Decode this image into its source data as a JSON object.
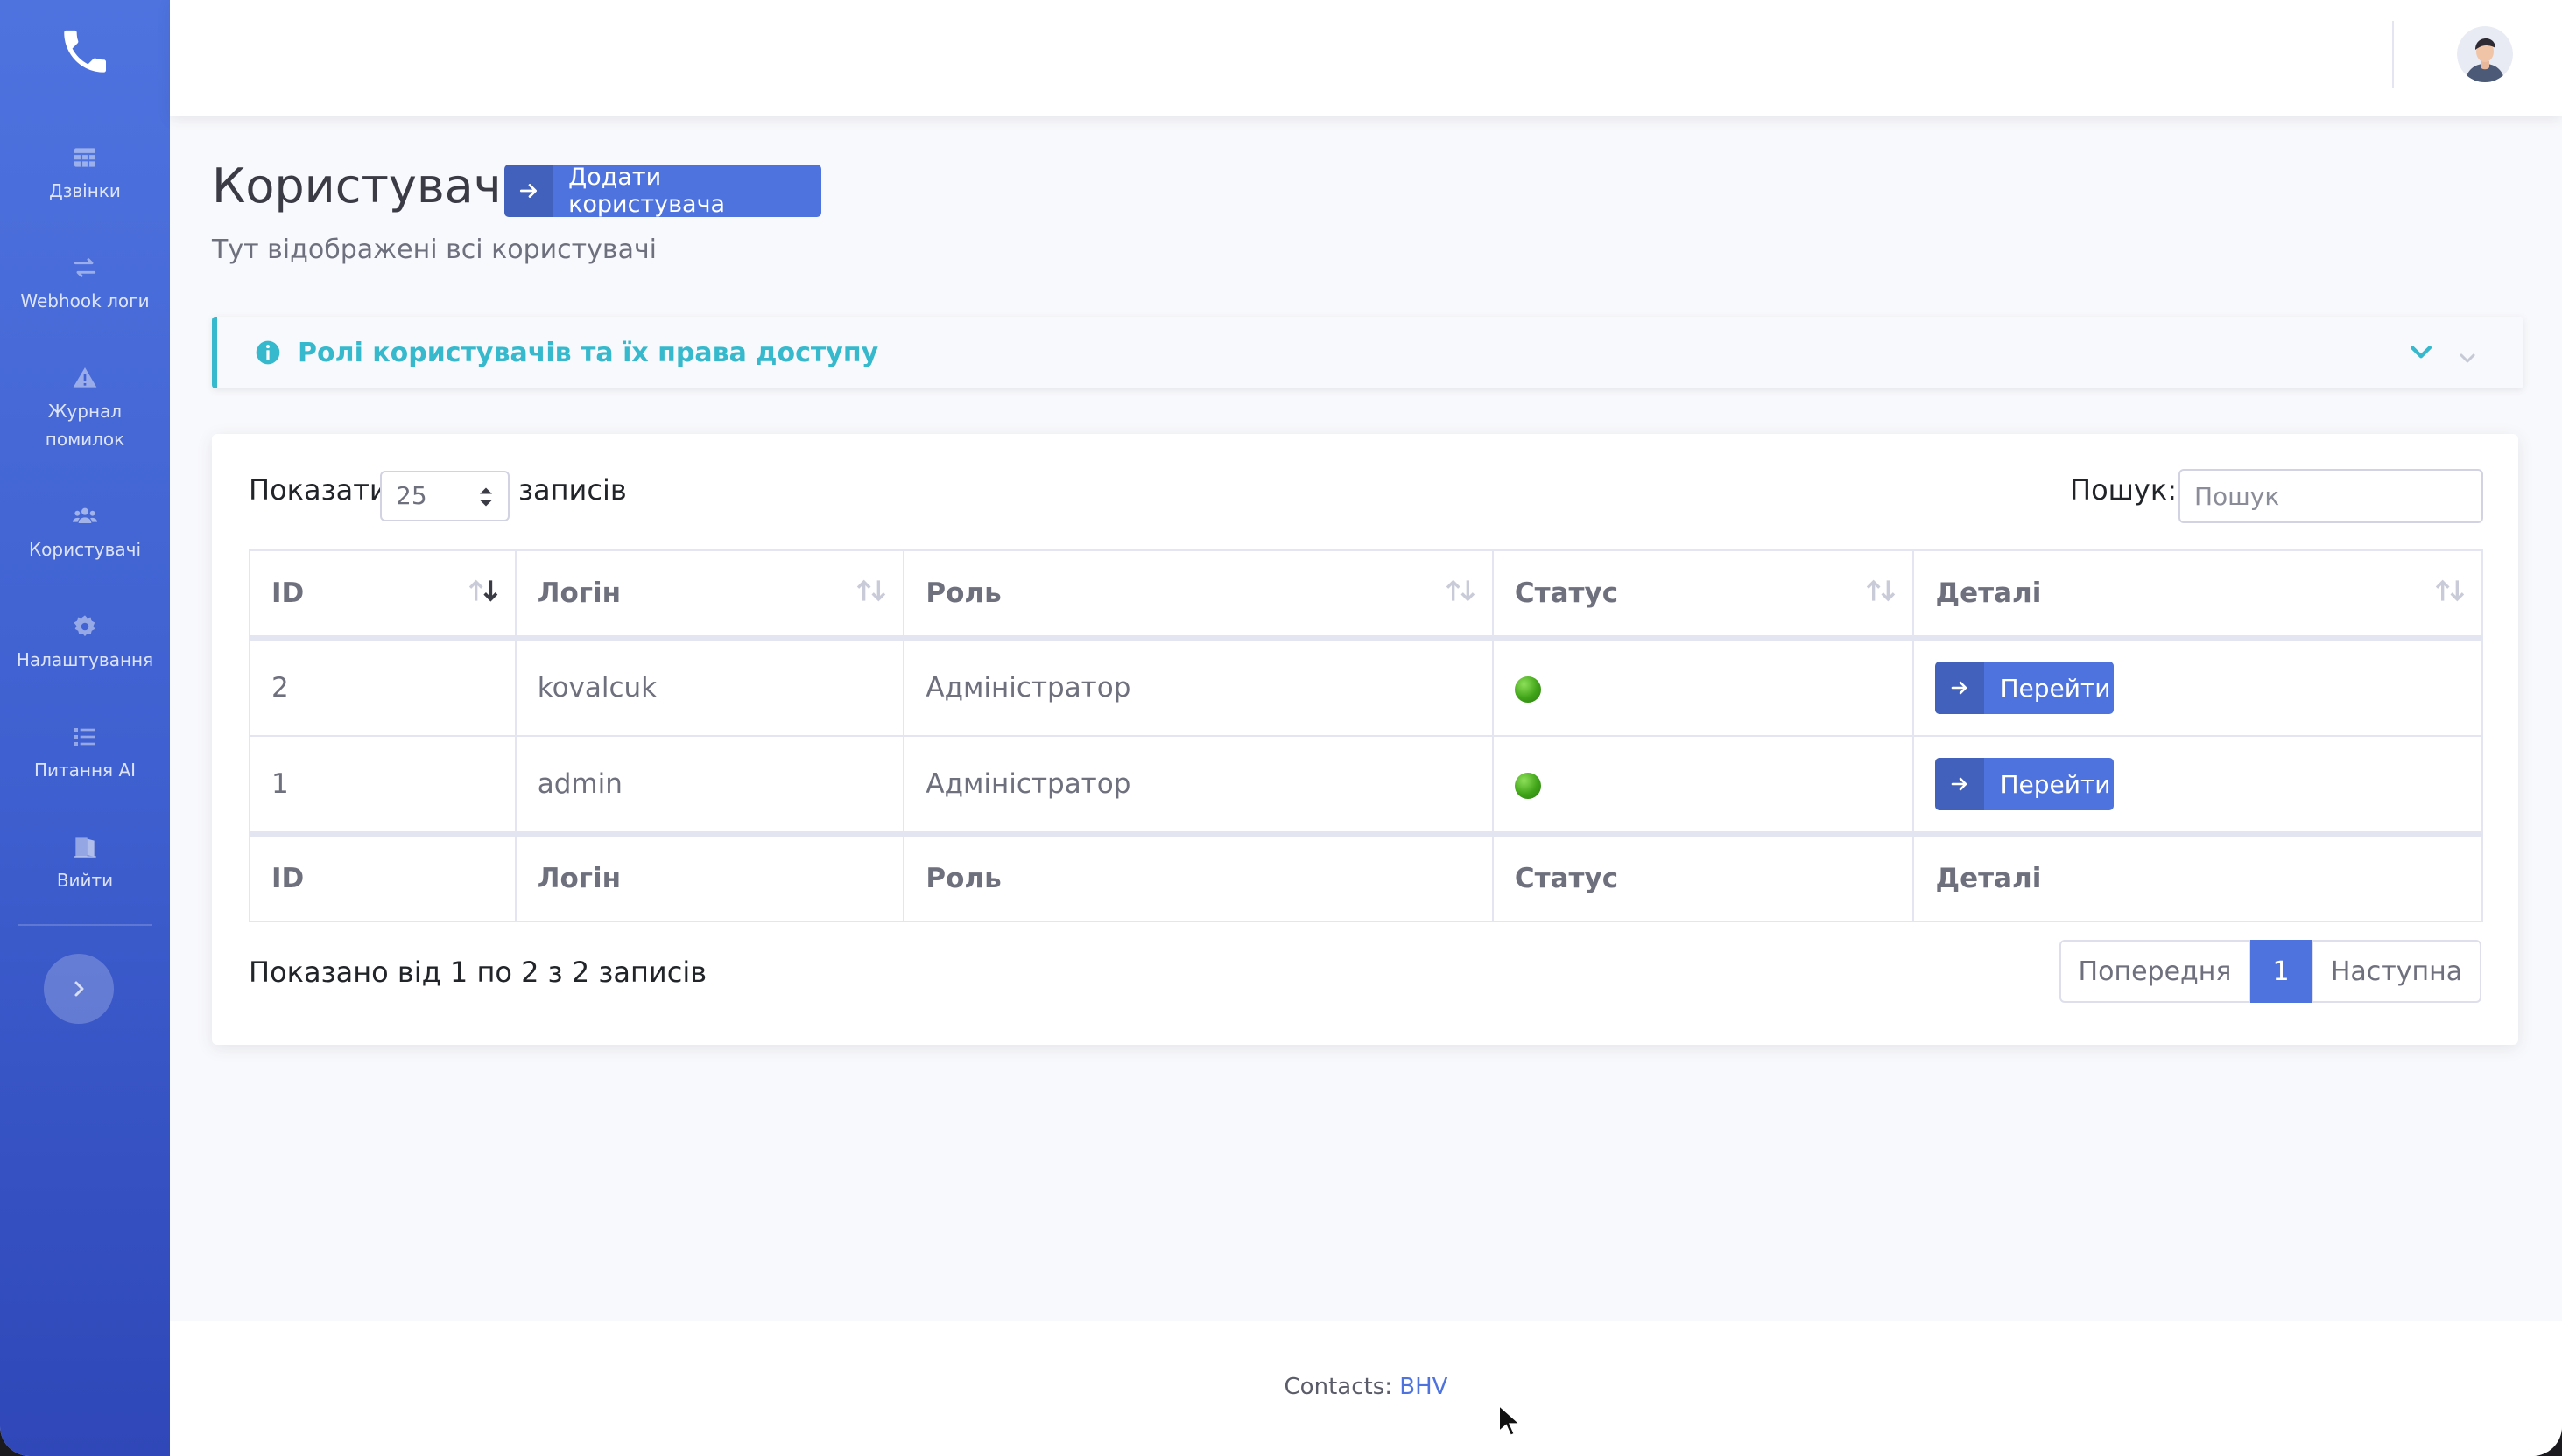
{
  "sidebar": {
    "items": [
      {
        "icon": "table-icon",
        "label": "Дзвінки"
      },
      {
        "icon": "exchange-icon",
        "label": "Webhook логи"
      },
      {
        "icon": "warning-icon",
        "label": "Журнал помилок"
      },
      {
        "icon": "users-icon",
        "label": "Користувачі"
      },
      {
        "icon": "gear-icon",
        "label": "Налаштування"
      },
      {
        "icon": "list-icon",
        "label": "Питання AI"
      },
      {
        "icon": "door-exit-icon",
        "label": "Вийти"
      }
    ]
  },
  "page": {
    "title": "Користувачі",
    "add_button": "Додати користувача",
    "subtitle": "Тут відображені всі користувачі"
  },
  "info_panel": {
    "text": "Ролі користувачів та їх права доступу"
  },
  "table_controls": {
    "show_label": "Показати",
    "page_length": "25",
    "entries_label": "записів",
    "search_label": "Пошук:",
    "search_placeholder": "Пошук"
  },
  "table": {
    "columns": [
      "ID",
      "Логін",
      "Роль",
      "Статус",
      "Деталі"
    ],
    "rows": [
      {
        "id": "2",
        "login": "kovalcuk",
        "role": "Адміністратор",
        "status": "active",
        "details": "Перейти"
      },
      {
        "id": "1",
        "login": "admin",
        "role": "Адміністратор",
        "status": "active",
        "details": "Перейти"
      }
    ],
    "info": "Показано від 1 по 2 з 2 записів"
  },
  "pagination": {
    "prev": "Попередня",
    "current": "1",
    "next": "Наступна"
  },
  "footer": {
    "label": "Contacts:",
    "link": "BHV"
  },
  "colors": {
    "primary": "#4e73df",
    "info": "#36b9cc",
    "status_active": "#3fa318"
  }
}
